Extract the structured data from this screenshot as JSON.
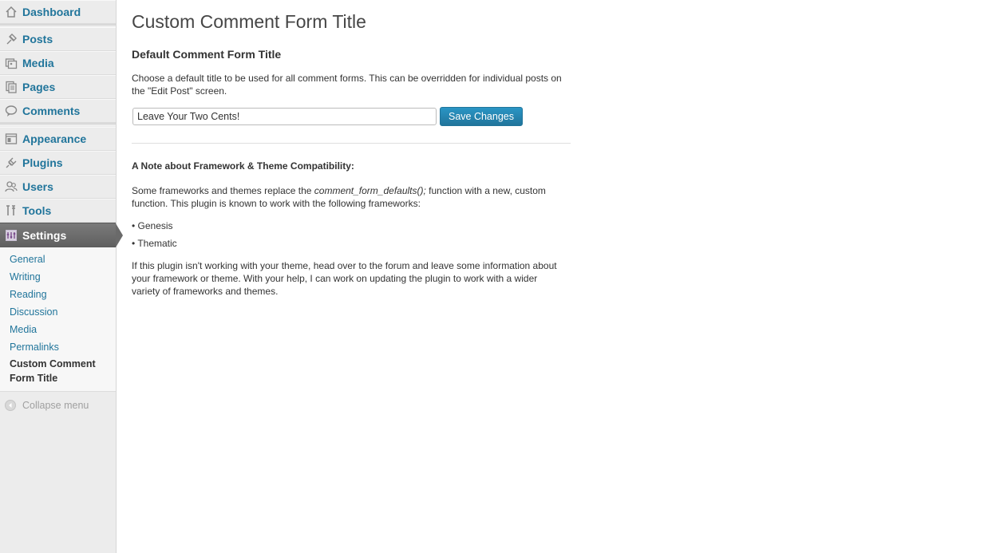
{
  "sidebar": {
    "items": [
      {
        "label": "Dashboard",
        "icon": "dashboard-icon"
      },
      {
        "label": "Posts",
        "icon": "pin-icon"
      },
      {
        "label": "Media",
        "icon": "media-icon"
      },
      {
        "label": "Pages",
        "icon": "pages-icon"
      },
      {
        "label": "Comments",
        "icon": "comment-bubble-icon"
      },
      {
        "label": "Appearance",
        "icon": "appearance-icon"
      },
      {
        "label": "Plugins",
        "icon": "plug-icon"
      },
      {
        "label": "Users",
        "icon": "users-icon"
      },
      {
        "label": "Tools",
        "icon": "tools-icon"
      },
      {
        "label": "Settings",
        "icon": "settings-icon"
      }
    ],
    "submenu": [
      {
        "label": "General"
      },
      {
        "label": "Writing"
      },
      {
        "label": "Reading"
      },
      {
        "label": "Discussion"
      },
      {
        "label": "Media"
      },
      {
        "label": "Permalinks"
      },
      {
        "label_line1": "Custom Comment",
        "label_line2": "Form Title"
      }
    ],
    "collapse_label": "Collapse menu"
  },
  "main": {
    "title": "Custom Comment Form Title",
    "section_title": "Default Comment Form Title",
    "description_line1": "Choose a default title to be used for all comment forms. This can be overridden for individual posts on",
    "description_line2": "the \"Edit Post\" screen.",
    "input_value": "Leave Your Two Cents!",
    "save_label": "Save Changes",
    "note_title": "A Note about Framework & Theme Compatibility:",
    "note_p1_a": "Some frameworks and themes replace the ",
    "note_p1_code": "comment_form_defaults();",
    "note_p1_b": " function with a new, custom",
    "note_p1_line2": "function. This plugin is known to work with the following frameworks:",
    "frameworks": [
      "• Genesis",
      "• Thematic"
    ],
    "note_p2_line1": "If this plugin isn't working with your theme, head over to the forum and leave some information about",
    "note_p2_line2": "your framework or theme. With your help, I can work on updating the plugin to work with a wider",
    "note_p2_line3": "variety of frameworks and themes."
  },
  "colors": {
    "link": "#21759b",
    "button": "#21759b",
    "current_menu": "#6a6a6a"
  }
}
